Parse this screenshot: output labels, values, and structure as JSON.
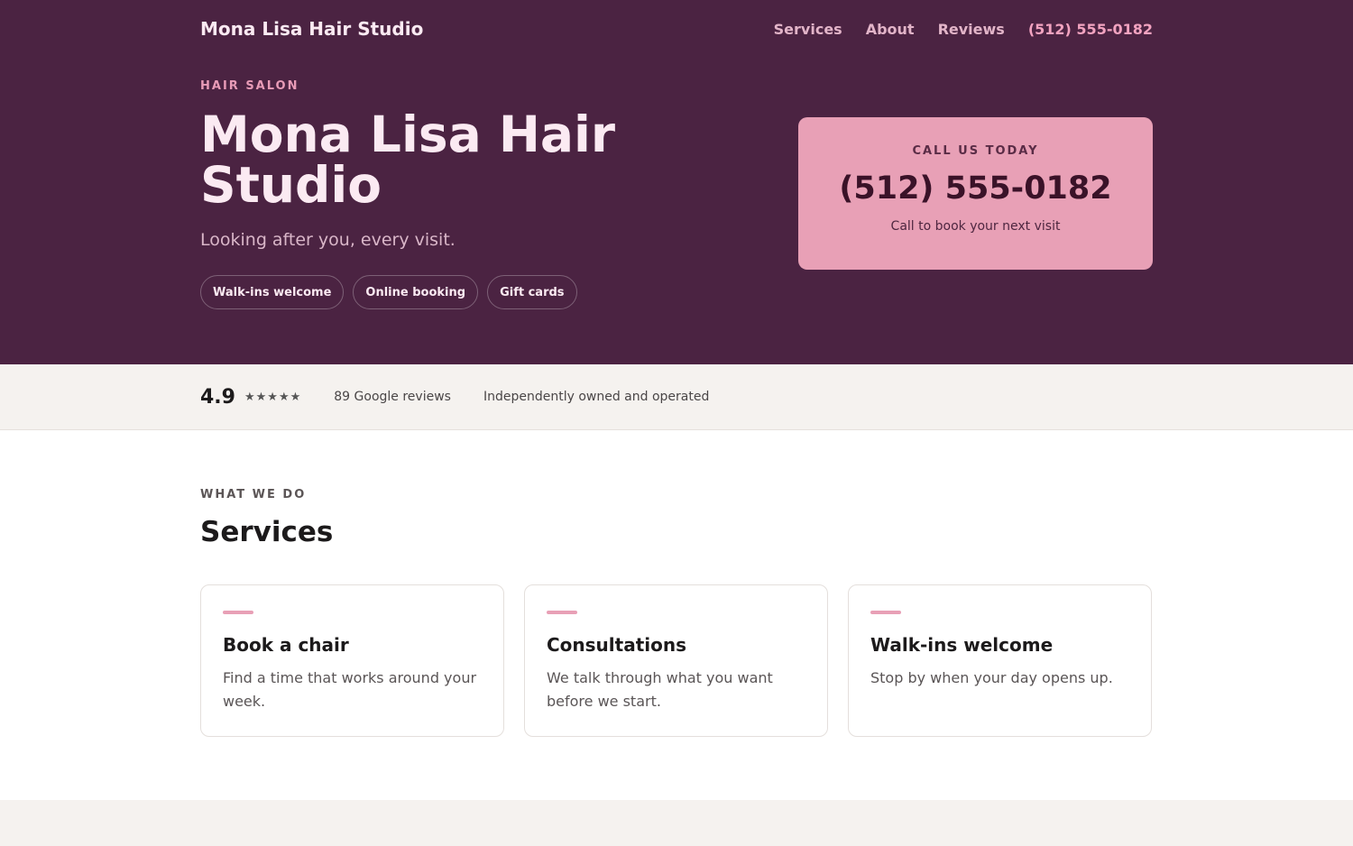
{
  "header": {
    "brand": "Mona Lisa Hair Studio",
    "nav": [
      "Services",
      "About",
      "Reviews"
    ],
    "phone": "(512) 555-0182"
  },
  "hero": {
    "eyebrow": "HAIR SALON",
    "title": "Mona Lisa Hair Studio",
    "tagline": "Looking after you, every visit.",
    "pills": [
      "Walk-ins welcome",
      "Online booking",
      "Gift cards"
    ]
  },
  "call_card": {
    "eyebrow": "CALL US TODAY",
    "phone": "(512) 555-0182",
    "note": "Call to book your next visit"
  },
  "trust": {
    "rating": "4.9",
    "stars": "★★★★★",
    "reviews": "89 Google reviews",
    "owned": "Independently owned and operated"
  },
  "services": {
    "eyebrow": "WHAT WE DO",
    "title": "Services",
    "cards": [
      {
        "title": "Book a chair",
        "text": "Find a time that works around your week."
      },
      {
        "title": "Consultations",
        "text": "We talk through what you want before we start."
      },
      {
        "title": "Walk-ins welcome",
        "text": "Stop by when your day opens up."
      }
    ]
  },
  "colors": {
    "hero_bg": "#4b2342",
    "accent_pink": "#e8a0b6",
    "band_bg": "#f5f2ef"
  }
}
